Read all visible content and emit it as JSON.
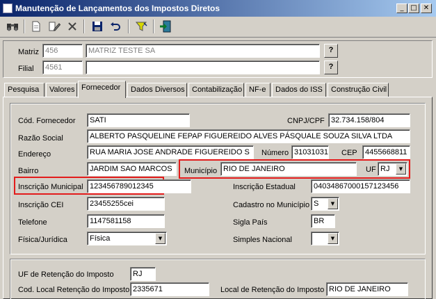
{
  "window": {
    "title": "Manutenção de Lançamentos dos Impostos Diretos",
    "min_glyph": "_",
    "max_glyph": "□",
    "close_glyph": "✕"
  },
  "toolbar": {
    "binoculars_glyph": "⛭",
    "new_glyph": "🗋",
    "edit_glyph": "✎",
    "delete_glyph": "✕",
    "save_glyph": "💾",
    "undo_glyph": "↶",
    "filter_glyph": "⧩",
    "exit_glyph": "⇥"
  },
  "header": {
    "matriz_label": "Matriz",
    "matriz_code": "456",
    "matriz_name": "MATRIZ TESTE SA",
    "filial_label": "Filial",
    "filial_code": "4561",
    "filial_name": "",
    "help_label": "?"
  },
  "tabs": [
    {
      "label": "Pesquisa"
    },
    {
      "label": "Valores"
    },
    {
      "label": "Fornecedor"
    },
    {
      "label": "Dados Diversos"
    },
    {
      "label": "Contabilização"
    },
    {
      "label": "NF-e"
    },
    {
      "label": "Dados do ISS"
    },
    {
      "label": "Construção Civil"
    }
  ],
  "fornecedor": {
    "cod_label": "Cód. Fornecedor",
    "cod_value": "SATI",
    "cnpj_label": "CNPJ/CPF",
    "cnpj_value": "32.734.158/804",
    "razao_label": "Razão Social",
    "razao_value": "ALBERTO PASQUELINE FEPAP FIGUEREIDO ALVES PÁSQUALE SOUZA SILVA LTDA",
    "endereco_label": "Endereço",
    "endereco_value": "RUA MARIA JOSE ANDRADE FIGUEREIDO S",
    "numero_label": "Número",
    "numero_value": "31031031",
    "cep_label": "CEP",
    "cep_value": "4455668811",
    "bairro_label": "Bairro",
    "bairro_value": "JARDIM SAO MARCOS",
    "municipio_label": "Município",
    "municipio_value": "RIO DE JANEIRO",
    "uf_label": "UF",
    "uf_value": "RJ",
    "insc_mun_label": "Inscrição Municipal",
    "insc_mun_value": "123456789012345",
    "insc_est_label": "Inscrição Estadual",
    "insc_est_value": "04034867000157123456",
    "insc_cei_label": "Inscrição CEI",
    "insc_cei_value": "23455255cei",
    "cad_mun_label": "Cadastro no Município",
    "cad_mun_value": "S",
    "telefone_label": "Telefone",
    "telefone_value": "1147581158",
    "sigla_pais_label": "Sigla País",
    "sigla_pais_value": "BR",
    "fisjur_label": "Física/Jurídica",
    "fisjur_value": "Física",
    "simples_label": "Simples Nacional",
    "simples_value": ""
  },
  "retencao": {
    "uf_label": "UF de Retenção do Imposto",
    "uf_value": "RJ",
    "cod_label": "Cod. Local Retenção do Imposto",
    "cod_value": "2335671",
    "local_label": "Local de Retenção do Imposto",
    "local_value": "RIO DE JANEIRO"
  },
  "colors": {
    "title_gradient_start": "#0a246a",
    "title_gradient_end": "#a6caf0",
    "highlight_red": "#e31b1b",
    "window_face": "#d4d0c8"
  }
}
